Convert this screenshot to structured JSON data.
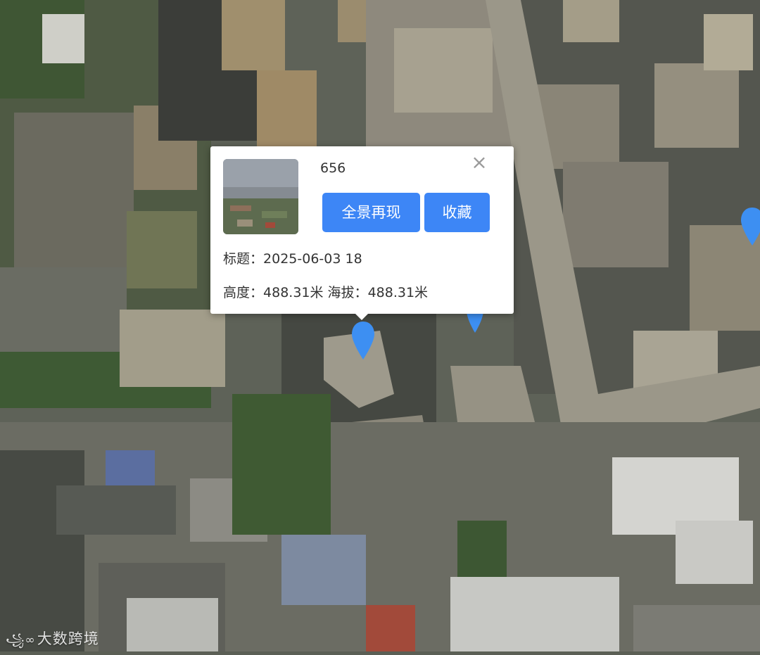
{
  "popup": {
    "title": "656",
    "panorama_button": "全景再现",
    "favorite_button": "收藏",
    "title_label": "标题：",
    "title_value": "2025-06-03 18",
    "height_label": "高度：",
    "height_value": "488.31米",
    "altitude_label": "海拔：",
    "altitude_value": "488.31米",
    "close_symbol": "×",
    "thumbnail_icon": "panorama-thumbnail"
  },
  "markers": [
    {
      "name": "marker-selected",
      "icon": "map-pin-icon",
      "color": "#3d8ff2"
    },
    {
      "name": "marker-2",
      "icon": "map-pin-icon",
      "color": "#3d8ff2"
    },
    {
      "name": "marker-3",
      "icon": "map-pin-icon",
      "color": "#3d8ff2"
    }
  ],
  "watermark": {
    "logo": "꧁∞",
    "text": "大数跨境"
  },
  "colors": {
    "accent": "#3d86f6",
    "marker": "#3d8ff2"
  }
}
